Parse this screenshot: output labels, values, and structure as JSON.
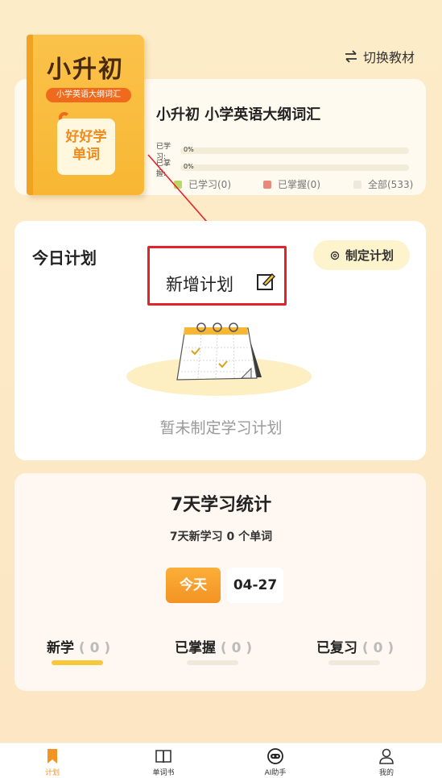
{
  "header": {
    "switch_label": "切换教材"
  },
  "book": {
    "cover_title": "小升初",
    "cover_subtitle": "小学英语大纲词汇",
    "cover_badge_line1": "好好学",
    "cover_badge_line2": "单词",
    "name": "小升初 小学英语大纲词汇",
    "learned_label": "已学习:",
    "learned_pct": "0%",
    "learned_value": 0,
    "mastered_label": "已掌握:",
    "mastered_pct": "0%",
    "mastered_value": 0,
    "legend": [
      {
        "label": "已学习(0)",
        "color": "#b9d86a"
      },
      {
        "label": "已掌握(0)",
        "color": "#e8897a"
      },
      {
        "label": "全部(533)",
        "color": "#eeeadb"
      }
    ]
  },
  "plan": {
    "title": "今日计划",
    "make_plan_label": "制定计划",
    "new_plan_label": "新增计划",
    "empty_text": "暂未制定学习计划"
  },
  "stats": {
    "title": "7天学习统计",
    "subtitle": "7天新学习 0 个单词",
    "today_label": "今天",
    "date_label": "04-27",
    "items": [
      {
        "label": "新学",
        "count": "( 0 )",
        "bar_color": "#f7c93a"
      },
      {
        "label": "已掌握",
        "count": "( 0 )",
        "bar_color": "#efe9dc"
      },
      {
        "label": "已复习",
        "count": "( 0 )",
        "bar_color": "#efe9dc"
      }
    ]
  },
  "tabs": [
    {
      "label": "计划",
      "icon": "bookmark-icon",
      "active": true
    },
    {
      "label": "单词书",
      "icon": "book-icon",
      "active": false
    },
    {
      "label": "AI助手",
      "icon": "robot-icon",
      "active": false
    },
    {
      "label": "我的",
      "icon": "person-icon",
      "active": false
    }
  ],
  "colors": {
    "accent": "#f39323",
    "highlight": "#e3232c"
  }
}
